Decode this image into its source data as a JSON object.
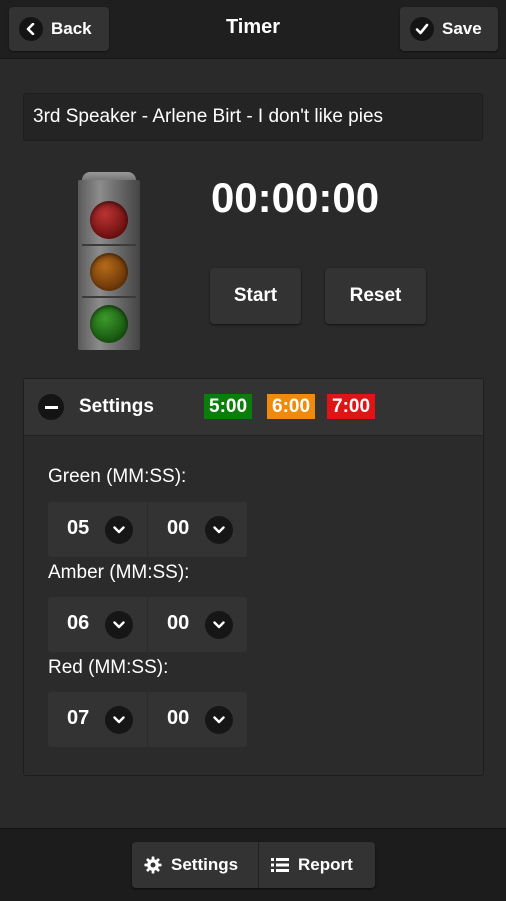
{
  "header": {
    "title": "Timer",
    "back_label": "Back",
    "save_label": "Save"
  },
  "speaker": {
    "text": "3rd Speaker - Arlene Birt - I don't like pies"
  },
  "timer": {
    "display": "00:00:00",
    "start_label": "Start",
    "reset_label": "Reset"
  },
  "settings": {
    "title": "Settings",
    "badges": {
      "green": "5:00",
      "amber": "6:00",
      "red": "7:00"
    },
    "green": {
      "label": "Green (MM:SS):",
      "minutes": "05",
      "seconds": "00"
    },
    "amber": {
      "label": "Amber (MM:SS):",
      "minutes": "06",
      "seconds": "00"
    },
    "red": {
      "label": "Red (MM:SS):",
      "minutes": "07",
      "seconds": "00"
    }
  },
  "footer": {
    "settings_label": "Settings",
    "report_label": "Report"
  },
  "colors": {
    "green": "#0b7d0b",
    "amber": "#f08a0b",
    "red": "#e01414"
  },
  "icons": [
    "chevron-left-icon",
    "check-icon",
    "minus-icon",
    "chevron-down-icon",
    "gear-icon",
    "list-icon"
  ]
}
